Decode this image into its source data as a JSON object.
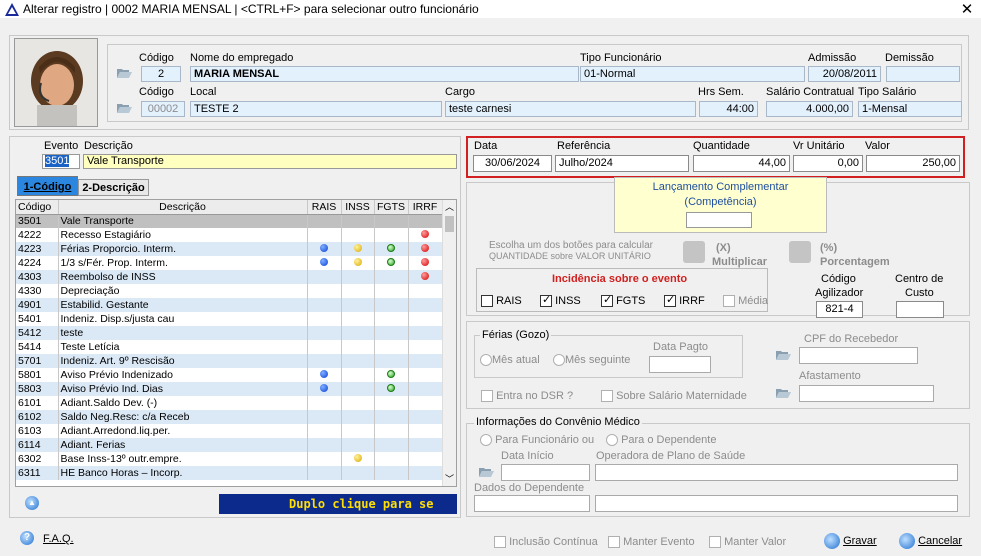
{
  "window": {
    "title": "Alterar registro | 0002 MARIA MENSAL | <CTRL+F> para selecionar outro funcionário",
    "close": "✕"
  },
  "employee": {
    "labels": {
      "codigo": "Código",
      "nome": "Nome do empregado",
      "tipo": "Tipo Funcionário",
      "admissao": "Admissão",
      "demissao": "Demissão",
      "codigo2": "Código",
      "local": "Local",
      "cargo": "Cargo",
      "hrs": "Hrs Sem.",
      "salario": "Salário Contratual",
      "tipo_sal": "Tipo Salário"
    },
    "codigo": "2",
    "nome": "MARIA MENSAL",
    "tipo": "01-Normal",
    "admissao": "20/08/2011",
    "demissao": "",
    "local_codigo": "00002",
    "local": "TESTE 2",
    "cargo": "teste carnesi",
    "hrs": "44:00",
    "salario": "4.000,00",
    "tipo_sal": "1-Mensal"
  },
  "event": {
    "label_evento": "Evento",
    "label_desc": "Descrição",
    "codigo": "3501",
    "descricao": "Vale Transporte"
  },
  "tabs": [
    "1-Código",
    "2-Descrição"
  ],
  "grid": {
    "headers": [
      "Código",
      "Descrição",
      "RAIS",
      "INSS",
      "FGTS",
      "IRRF"
    ],
    "rows": [
      {
        "code": "3501",
        "desc": "Vale Transporte",
        "rais": "",
        "inss": "",
        "fgts": "",
        "irrf": "",
        "sel": true
      },
      {
        "code": "4222",
        "desc": "Recesso Estagiário",
        "rais": "",
        "inss": "",
        "fgts": "",
        "irrf": "r"
      },
      {
        "code": "4223",
        "desc": "Férias Proporcio. Interm.",
        "rais": "b",
        "inss": "y",
        "fgts": "g",
        "irrf": "r"
      },
      {
        "code": "4224",
        "desc": "1/3 s/Fér. Prop. Interm.",
        "rais": "b",
        "inss": "y",
        "fgts": "g",
        "irrf": "r"
      },
      {
        "code": "4303",
        "desc": "Reembolso de INSS",
        "rais": "",
        "inss": "",
        "fgts": "",
        "irrf": "r"
      },
      {
        "code": "4330",
        "desc": "Depreciação",
        "rais": "",
        "inss": "",
        "fgts": "",
        "irrf": ""
      },
      {
        "code": "4901",
        "desc": "Estabilid. Gestante",
        "rais": "",
        "inss": "",
        "fgts": "",
        "irrf": ""
      },
      {
        "code": "5401",
        "desc": "Indeniz. Disp.s/justa cau",
        "rais": "",
        "inss": "",
        "fgts": "",
        "irrf": ""
      },
      {
        "code": "5412",
        "desc": "teste",
        "rais": "",
        "inss": "",
        "fgts": "",
        "irrf": ""
      },
      {
        "code": "5414",
        "desc": "Teste Letícia",
        "rais": "",
        "inss": "",
        "fgts": "",
        "irrf": ""
      },
      {
        "code": "5701",
        "desc": "Indeniz. Art. 9º Rescisão",
        "rais": "",
        "inss": "",
        "fgts": "",
        "irrf": ""
      },
      {
        "code": "5801",
        "desc": "Aviso Prévio Indenizado",
        "rais": "b",
        "inss": "",
        "fgts": "g",
        "irrf": ""
      },
      {
        "code": "5803",
        "desc": "Aviso Prévio Ind. Dias",
        "rais": "b",
        "inss": "",
        "fgts": "g",
        "irrf": ""
      },
      {
        "code": "6101",
        "desc": "Adiant.Saldo Dev. (-)",
        "rais": "",
        "inss": "",
        "fgts": "",
        "irrf": ""
      },
      {
        "code": "6102",
        "desc": "Saldo Neg.Resc: c/a Receb",
        "rais": "",
        "inss": "",
        "fgts": "",
        "irrf": ""
      },
      {
        "code": "6103",
        "desc": "Adiant.Arredond.liq.per.",
        "rais": "",
        "inss": "",
        "fgts": "",
        "irrf": ""
      },
      {
        "code": "6114",
        "desc": "Adiant. Ferias",
        "rais": "",
        "inss": "",
        "fgts": "",
        "irrf": ""
      },
      {
        "code": "6302",
        "desc": "Base Inss-13º outr.empre.",
        "rais": "",
        "inss": "y",
        "fgts": "",
        "irrf": ""
      },
      {
        "code": "6311",
        "desc": "HE Banco Horas – Incorp.",
        "rais": "",
        "inss": "",
        "fgts": "",
        "irrf": ""
      }
    ]
  },
  "marquee": "Duplo clique para se",
  "lancamento": {
    "labels": {
      "data": "Data",
      "referencia": "Referência",
      "quantidade": "Quantidade",
      "vr": "Vr Unitário",
      "valor": "Valor"
    },
    "data": "30/06/2024",
    "referencia": "Julho/2024",
    "quantidade": "44,00",
    "vr": "0,00",
    "valor": "250,00"
  },
  "complementar": {
    "line1": "Lançamento Complementar",
    "line2": "(Competência)",
    "value": ""
  },
  "calc": {
    "line1": "Escolha um dos botões para calcular",
    "line2": "QUANTIDADE sobre VALOR UNITÁRIO",
    "mult1": "(X)",
    "mult2": "Multiplicar",
    "perc1": "(%)",
    "perc2": "Porcentagem"
  },
  "incidencia": {
    "title": "Incidência sobre o evento",
    "items": [
      {
        "label": "RAIS",
        "on": false
      },
      {
        "label": "INSS",
        "on": true
      },
      {
        "label": "FGTS",
        "on": true
      },
      {
        "label": "IRRF",
        "on": true
      },
      {
        "label": "Média",
        "on": false
      }
    ]
  },
  "agilizador": {
    "label1": "Código",
    "label2": "Agilizador",
    "value": "821-4",
    "cc1": "Centro de",
    "cc2": "Custo",
    "cc": ""
  },
  "ferias": {
    "title": "Férias (Gozo)",
    "mes_atual": "Mês atual",
    "mes_seguinte": "Mês seguinte",
    "data_pagto": "Data Pagto",
    "dsr": "Entra no DSR ?",
    "sobre": "Sobre Salário Maternidade",
    "cpf": "CPF do Recebedor",
    "afastamento": "Afastamento"
  },
  "convenio": {
    "title": "Informações do Convênio Médico",
    "func": "Para Funcionário ou",
    "dep": "Para o Dependente",
    "inicio": "Data Início",
    "operadora": "Operadora de Plano de Saúde",
    "dados": "Dados do Dependente"
  },
  "footer": {
    "faq": "F.A.Q.",
    "inclusao": "Inclusão Contínua",
    "manter_evento": "Manter Evento",
    "manter_valor": "Manter Valor",
    "gravar": "Gravar",
    "cancelar": "Cancelar"
  },
  "colors": {
    "highlight": "#d21f1f",
    "fieldbg": "#e3f1fd",
    "marqueebg": "#0b2a8c",
    "marqueefg": "#ffde00"
  }
}
